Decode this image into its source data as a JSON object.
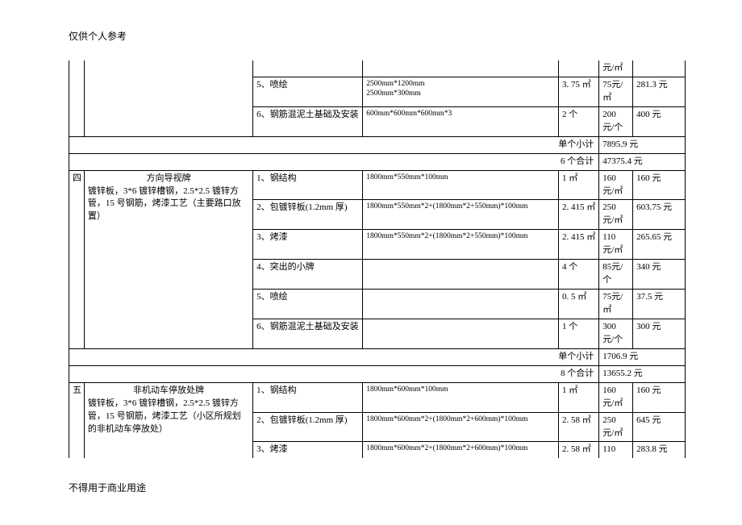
{
  "header_note": "仅供个人参考",
  "footer_note": "不得用于商业用途",
  "unit_rate_per_m2": "元/㎡",
  "unit_rate_per_piece": "元/个",
  "unit_rate_per_m2_short": "75元/㎡",
  "labels": {
    "single_subtotal": "单个小计",
    "six_total": "6 个合计",
    "eight_total": "8 个合计"
  },
  "section_top": {
    "rate_unit_row": "元/㎡",
    "r5": {
      "step": "5、喷绘",
      "spec1": "2500mm*1200mm",
      "spec2": "2500mm*300mm",
      "qty": "3. 75 ㎡",
      "rate": "75元/㎡",
      "total": "281.3 元"
    },
    "r6": {
      "step": "6、钢筋混泥土基础及安装",
      "spec": "600mm*600mm*600mm*3",
      "qty": "2 个",
      "rate": "200 元/个",
      "total": "400 元"
    },
    "subtotal_single": "7895.9 元",
    "subtotal_six": "47375.4 元"
  },
  "section_four": {
    "idx": "四",
    "desc_title": "方向导视牌",
    "desc_body": "镀锌板，3*6 镀锌槽钢，2.5*2.5 镀锌方管，15 号钢筋，烤漆工艺（主要路口放置）",
    "r1": {
      "step": "1、钢结构",
      "spec": "1800mm*550mm*100mm",
      "qty": "1 ㎡",
      "rate": "160 元/㎡",
      "total": "160 元"
    },
    "r2": {
      "step": "2、包镀锌板(1.2mm 厚)",
      "spec": "1800mm*550mm*2+(1800mm*2+550mm)*100mm",
      "qty": "2. 415 ㎡",
      "rate": "250 元/㎡",
      "total": "603.75 元"
    },
    "r3": {
      "step": "3、烤漆",
      "spec": "1800mm*550mm*2+(1800mm*2+550mm)*100mm",
      "qty": "2. 415 ㎡",
      "rate": "110 元/㎡",
      "total": "265.65 元"
    },
    "r4": {
      "step": "4、突出的小牌",
      "spec": "",
      "qty": "4 个",
      "rate": "85元/个",
      "total": "340 元"
    },
    "r5": {
      "step": "5、喷绘",
      "spec": "",
      "qty": "0. 5 ㎡",
      "rate": "75元/㎡",
      "total": "37.5 元"
    },
    "r6": {
      "step": "6、钢筋混泥土基础及安装",
      "spec": "",
      "qty": "1 个",
      "rate": "300 元/个",
      "total": "300 元"
    },
    "subtotal_single": "1706.9 元",
    "subtotal_eight": "13655.2 元"
  },
  "section_five": {
    "idx": "五",
    "desc_title": "非机动车停放处牌",
    "desc_body": "镀锌板，3*6 镀锌槽钢，2.5*2.5 镀锌方管，15 号钢筋，烤漆工艺（小区所规划的非机动车停放处）",
    "r1": {
      "step": "1、钢结构",
      "spec": "1800mm*600mm*100mm",
      "qty": "1 ㎡",
      "rate": "160 元/㎡",
      "total": "160 元"
    },
    "r2": {
      "step": "2、包镀锌板(1.2mm 厚)",
      "spec": "1800mm*600mm*2+(1800mm*2+600mm)*100mm",
      "qty": "2. 58 ㎡",
      "rate": "250 元/㎡",
      "total": "645 元"
    },
    "r3": {
      "step": "3、烤漆",
      "spec": "1800mm*600mm*2+(1800mm*2+600mm)*100mm",
      "qty": "2. 58 ㎡",
      "rate": "110",
      "total": "283.8 元"
    }
  }
}
